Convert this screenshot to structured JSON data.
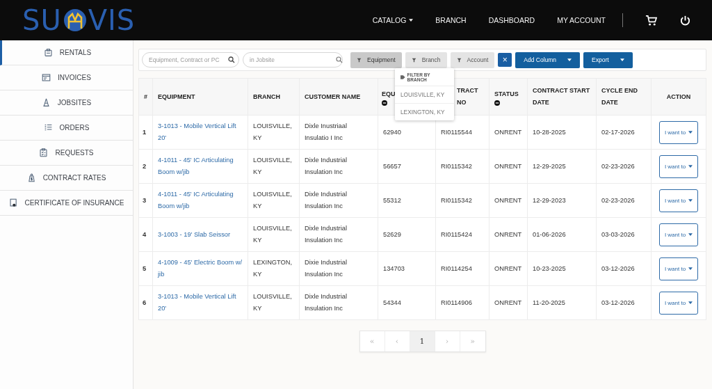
{
  "logo": {
    "left": "SU",
    "right": "VIS"
  },
  "nav": [
    {
      "label": "CATALOG",
      "dropdown": true
    },
    {
      "label": "BRANCH",
      "dropdown": false
    },
    {
      "label": "DASHBOARD",
      "dropdown": false
    },
    {
      "label": "MY ACCOUNT",
      "dropdown": false
    }
  ],
  "sidebar": {
    "items": [
      {
        "label": "RENTALS",
        "selected": true
      },
      {
        "label": "INVOICES",
        "selected": false
      },
      {
        "label": "JOBSITES",
        "selected": false
      },
      {
        "label": "ORDERS",
        "selected": false
      },
      {
        "label": "REQUESTS",
        "selected": false
      },
      {
        "label": "CONTRACT RATES",
        "selected": false
      },
      {
        "label": "CERTIFICATE OF INSURANCE",
        "selected": false
      }
    ]
  },
  "toolbar": {
    "search": {
      "placeholder": "Equipment, Contract or PC"
    },
    "jobsite": {
      "placeholder": "in Jobsite"
    },
    "filters": [
      {
        "label": "Equipment",
        "active": true
      },
      {
        "label": "Branch",
        "active": false
      },
      {
        "label": "Account",
        "active": false
      }
    ],
    "clear": "×",
    "buttons": [
      {
        "label": "Add Column"
      },
      {
        "label": "Export"
      }
    ]
  },
  "branch_menu": {
    "title": "FILTER BY BRANCH",
    "options": [
      "LOUISVILLE, KY",
      "LEXINGTON, KY"
    ]
  },
  "table": {
    "columns": [
      {
        "label": "#",
        "collapse": false
      },
      {
        "label": "EQUIPMENT",
        "collapse": false
      },
      {
        "label": "BRANCH",
        "collapse": false
      },
      {
        "label": "CUSTOMER NAME",
        "collapse": false
      },
      {
        "label": "EQU",
        "collapse": true
      },
      {
        "label": "TRACT NO",
        "collapse": false
      },
      {
        "label": "STATUS",
        "collapse": true
      },
      {
        "label": "CONTRACT START DATE",
        "collapse": false
      },
      {
        "label": "CYCLE END DATE",
        "collapse": false
      },
      {
        "label": "ACTION",
        "collapse": false
      }
    ],
    "rows": [
      {
        "num": "1",
        "equipment": "3-1013 - Mobile Vertical Lift 20'",
        "branch": "LOUISVILLE, KY",
        "customer": "Dixle Inustriaal Insulatio I Inc",
        "equipment_no": "62940",
        "contract_no": "RI0115544",
        "status": "ONRENT",
        "start": "10-28-2025",
        "cycle_end": "02-17-2026",
        "action": "I want to"
      },
      {
        "num": "2",
        "equipment": "4-1011 - 45' IC Articulating Boom w/jib",
        "branch": "LOUISVILLE, KY",
        "customer": "Dixle Industrial Insulation Inc",
        "equipment_no": "56657",
        "contract_no": "RI0115342",
        "status": "ONRENT",
        "start": "12-29-2025",
        "cycle_end": "02-23-2026",
        "action": "I want to"
      },
      {
        "num": "3",
        "equipment": "4-1011 - 45' IC Articulating Boom w/jib",
        "branch": "LOUISVILLE, KY",
        "customer": "Dixle Industrial Insulation Inc",
        "equipment_no": "55312",
        "contract_no": "RI0115342",
        "status": "ONRENT",
        "start": "12-29-2023",
        "cycle_end": "02-23-2026",
        "action": "I want to"
      },
      {
        "num": "4",
        "equipment": "3-1003 - 19' Slab Seissor",
        "branch": "LOUISVILLE, KY",
        "customer": "Dixle Industrial Insulation Inc",
        "equipment_no": "52629",
        "contract_no": "RI0115424",
        "status": "ONRENT",
        "start": "01-06-2026",
        "cycle_end": "03-03-2026",
        "action": "I want to"
      },
      {
        "num": "5",
        "equipment": "4-1009 - 45' Electric Boom w/ jib",
        "branch": "LEXINGTON, KY",
        "customer": "Dixie Industrial Insulation Inc",
        "equipment_no": "134703",
        "contract_no": "RI0114254",
        "status": "ONRENT",
        "start": "10-23-2025",
        "cycle_end": "03-12-2026",
        "action": "I want to"
      },
      {
        "num": "6",
        "equipment": "3-1013 - Mobile Vertical Lift 20'",
        "branch": "LOUISVILLE, KY",
        "customer": "Dixle Industrial Insulation Inc",
        "equipment_no": "54344",
        "contract_no": "RI0114906",
        "status": "ONRENT",
        "start": "11-20-2025",
        "cycle_end": "03-12-2026",
        "action": "I want to"
      }
    ]
  },
  "pagination": [
    {
      "label": "«",
      "selected": false
    },
    {
      "label": "‹",
      "selected": false
    },
    {
      "label": "1",
      "selected": true
    },
    {
      "label": "›",
      "selected": false
    },
    {
      "label": "»",
      "selected": false
    }
  ]
}
